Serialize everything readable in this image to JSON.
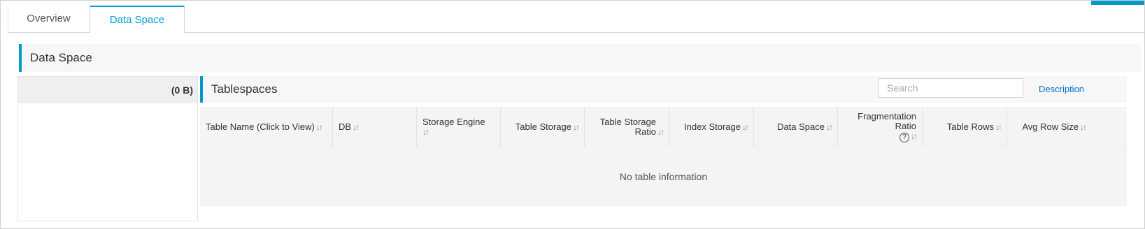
{
  "tabs": [
    {
      "label": "Overview"
    },
    {
      "label": "Data Space"
    }
  ],
  "section": {
    "title": "Data Space"
  },
  "left_panel": {
    "size_label": "(0 B)"
  },
  "tablespaces": {
    "title": "Tablespaces",
    "search_placeholder": "Search",
    "description_link": "Description",
    "columns": [
      {
        "label": "Table Name (Click to View)"
      },
      {
        "label": "DB"
      },
      {
        "label": "Storage Engine"
      },
      {
        "label": "Table Storage"
      },
      {
        "label": "Table Storage Ratio"
      },
      {
        "label": "Index Storage"
      },
      {
        "label": "Data Space"
      },
      {
        "label": "Fragmentation Ratio"
      },
      {
        "label": "Table Rows"
      },
      {
        "label": "Avg Row Size"
      }
    ],
    "empty_text": "No table information"
  },
  "icons": {
    "sort": "sort-arrows-icon",
    "help": "question-circle-icon"
  },
  "colors": {
    "accent": "#0099cc",
    "active_tab": "#00a1d6",
    "link": "#0070cc"
  }
}
